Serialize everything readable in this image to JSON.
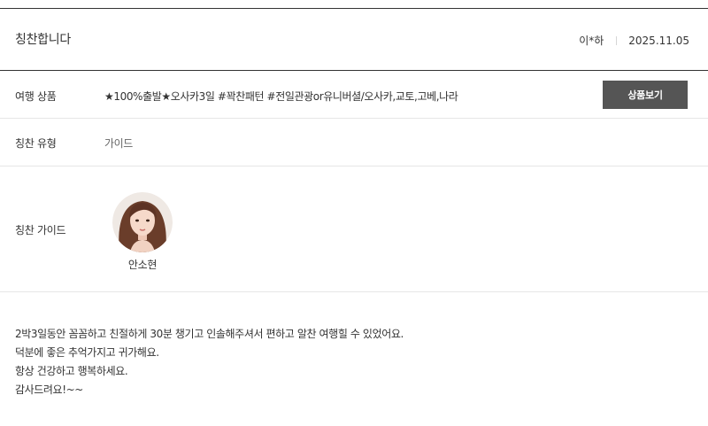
{
  "header": {
    "title": "칭찬합니다",
    "author": "이*하",
    "date": "2025.11.05"
  },
  "product": {
    "label": "여행 상품",
    "value": "★100%출발★오사카3일 #꽉찬패턴 #전일관광or유니버셜/오사카,교토,고베,나라",
    "button_label": "상품보기"
  },
  "praise_type": {
    "label": "칭찬 유형",
    "value": "가이드"
  },
  "guide": {
    "label": "칭찬 가이드",
    "name": "안소현",
    "photo": "guide-portrait"
  },
  "content": {
    "lines": [
      "2박3일동안 꼼꼼하고 친절하게 30분 챙기고 인솔해주셔서 편하고 알찬 여행힐 수 있었어요.",
      "덕분에 좋은 추억가지고 귀가해요.",
      "항상 건강하고 행복하세요.",
      "감사드려요!~~"
    ]
  },
  "colors": {
    "rule": "#333333",
    "divider": "#e6e6e6",
    "button_bg": "#555555",
    "button_text": "#ffffff"
  }
}
